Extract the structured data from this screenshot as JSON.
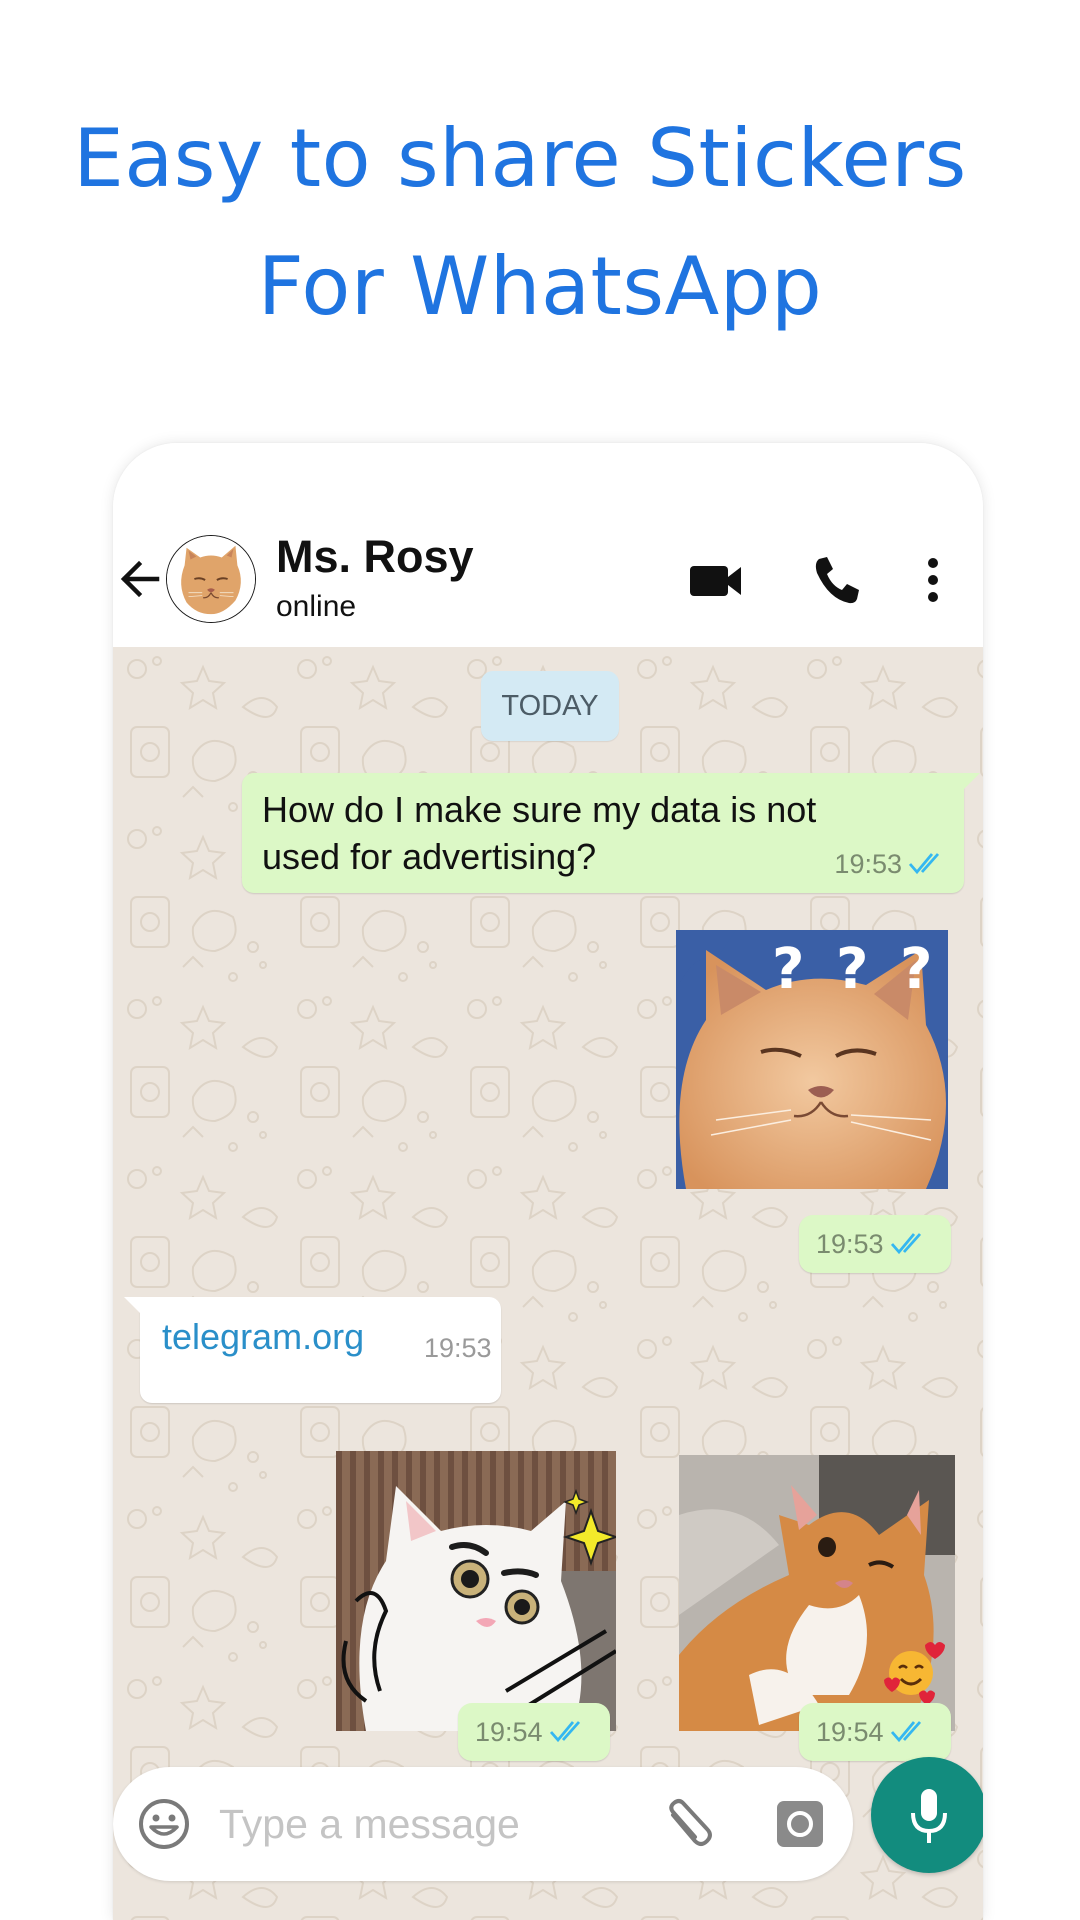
{
  "headline": {
    "line1": "Easy to share Stickers",
    "line2": "For WhatsApp"
  },
  "appbar": {
    "back_icon": "arrow-left-icon",
    "contact_name": "Ms. Rosy",
    "contact_status": "online",
    "actions": [
      {
        "name": "video-call",
        "icon": "video-camera-icon"
      },
      {
        "name": "voice-call",
        "icon": "phone-icon"
      },
      {
        "name": "more-options",
        "icon": "more-vertical-icon"
      }
    ]
  },
  "chat": {
    "date_label": "TODAY",
    "messages": [
      {
        "direction": "outgoing",
        "type": "text",
        "text": "How do I make sure my data is not used for advertising?",
        "time": "19:53",
        "status": "read"
      },
      {
        "direction": "outgoing",
        "type": "sticker",
        "sticker": "orange cat with question marks",
        "time": "19:53",
        "status": "read"
      },
      {
        "direction": "incoming",
        "type": "link",
        "text": "telegram.org",
        "time": "19:53"
      },
      {
        "direction": "outgoing",
        "type": "sticker",
        "sticker": "white cat with drawn eyebrows and sparkles",
        "time": "19:54",
        "status": "read"
      },
      {
        "direction": "outgoing",
        "type": "sticker",
        "sticker": "ginger cat winking with smiling-hearts emoji",
        "time": "19:54",
        "status": "read"
      }
    ]
  },
  "composer": {
    "placeholder": "Type a message",
    "value": "",
    "emoji_icon": "smiley-icon",
    "attach_icon": "paperclip-icon",
    "camera_icon": "camera-icon",
    "mic_icon": "microphone-icon"
  },
  "colors": {
    "headline": "#1f74e0",
    "outgoing_bubble": "#dcf8c6",
    "incoming_bubble": "#ffffff",
    "chat_background": "#ece5dd",
    "read_ticks": "#34b7f1",
    "link": "#2a8fc9",
    "mic_button": "#128c7e",
    "date_chip": "#d4eaf4"
  }
}
